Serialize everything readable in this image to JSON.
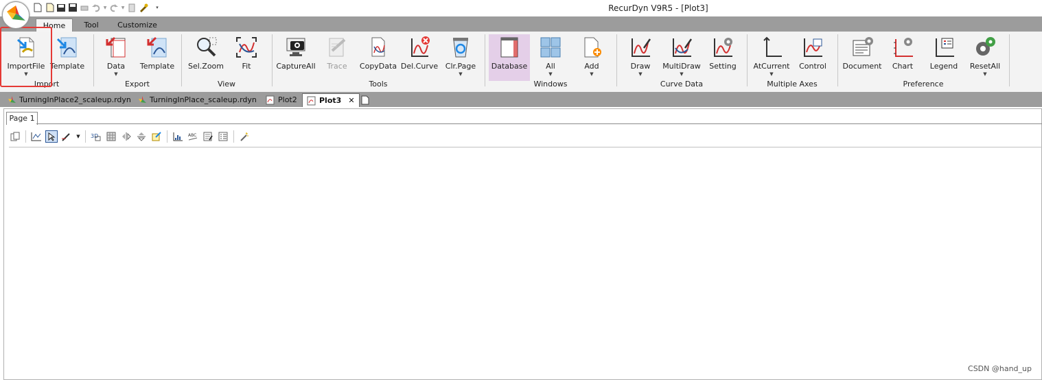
{
  "window": {
    "title": "RecurDyn V9R5  - [Plot3]"
  },
  "ribbon_tabs": [
    "Home",
    "Tool",
    "Customize"
  ],
  "ribbon": {
    "buttons": {
      "import_file": "ImportFile",
      "import_template": "Template",
      "export_data": "Data",
      "export_template": "Template",
      "sel_zoom": "Sel.Zoom",
      "fit": "Fit",
      "capture_all": "CaptureAll",
      "trace": "Trace",
      "copy_data": "CopyData",
      "del_curve": "Del.Curve",
      "clr_page": "Clr.Page",
      "database": "Database",
      "all": "All",
      "add": "Add",
      "draw": "Draw",
      "multi_draw": "MultiDraw",
      "setting": "Setting",
      "at_current": "AtCurrent",
      "control": "Control",
      "document": "Document",
      "chart": "Chart",
      "legend": "Legend",
      "reset_all": "ResetAll"
    },
    "groups": {
      "import": "Import",
      "export": "Export",
      "view": "View",
      "tools": "Tools",
      "windows": "Windows",
      "curve_data": "Curve Data",
      "multiple_axes": "Multiple Axes",
      "preference": "Preference"
    }
  },
  "doc_tabs": [
    "TurningInPlace2_scaleup.rdyn",
    "TurningInPlace_scaleup.rdyn",
    "Plot2",
    "Plot3"
  ],
  "plot": {
    "page_tab": "Page 1"
  },
  "watermark": "CSDN @hand_up",
  "colors": {
    "highlight": "#e53935",
    "selected": "#e4cfe8",
    "curve_red": "#d32f2f",
    "curve_blue": "#2b5797"
  }
}
